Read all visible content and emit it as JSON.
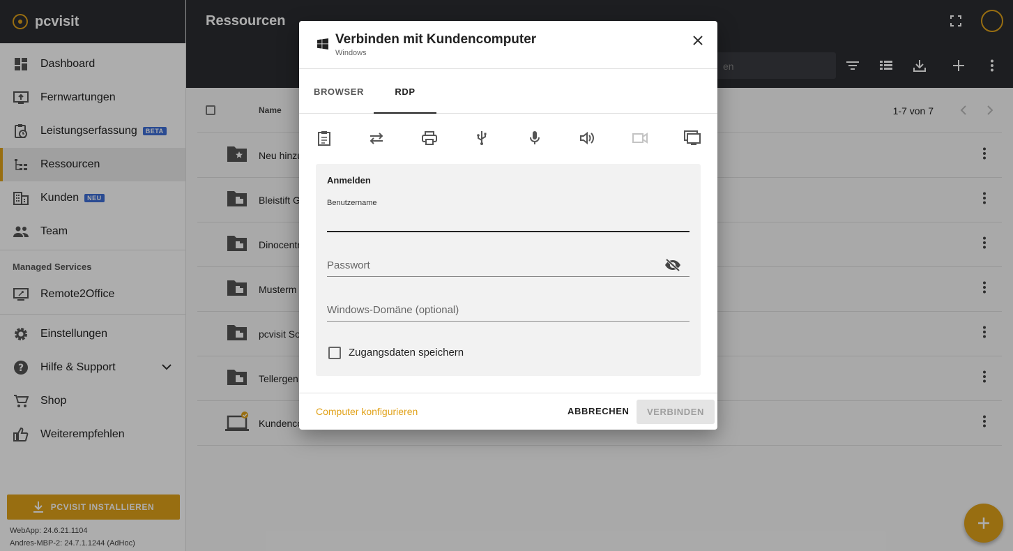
{
  "sidebar": {
    "brand": "pcvisit",
    "items": [
      {
        "label": "Dashboard",
        "icon": "dashboard-icon"
      },
      {
        "label": "Fernwartungen",
        "icon": "remote-icon"
      },
      {
        "label": "Leistungserfassung",
        "icon": "time-tracking-icon",
        "badge": "BETA"
      },
      {
        "label": "Ressourcen",
        "icon": "resources-icon",
        "active": true
      },
      {
        "label": "Kunden",
        "icon": "customers-icon",
        "badge": "NEU"
      },
      {
        "label": "Team",
        "icon": "team-icon"
      }
    ],
    "section_title": "Managed Services",
    "section_items": [
      {
        "label": "Remote2Office",
        "icon": "remote2office-icon"
      }
    ],
    "bottom_items": [
      {
        "label": "Einstellungen",
        "icon": "gear-icon"
      },
      {
        "label": "Hilfe & Support",
        "icon": "help-icon"
      },
      {
        "label": "Shop",
        "icon": "cart-icon"
      },
      {
        "label": "Weiterempfehlen",
        "icon": "thumbs-up-icon"
      }
    ],
    "install_label": "PCVISIT INSTALLIEREN",
    "webapp_version": "WebApp: 24.6.21.1104",
    "host_version": "Andres-MBP-2: 24.7.1.1244 (AdHoc)"
  },
  "header": {
    "title": "Ressourcen",
    "search_placeholder_fragment": "en"
  },
  "table": {
    "column_name": "Name",
    "pagination": "1-7 von 7",
    "rows": [
      {
        "name": "Neu hinzu",
        "icon": "folder-star-icon"
      },
      {
        "name": "Bleistift G",
        "icon": "folder-building-icon"
      },
      {
        "name": "Dinocentr",
        "icon": "folder-building-icon"
      },
      {
        "name": "Musterm",
        "icon": "folder-building-icon"
      },
      {
        "name": "pcvisit So",
        "icon": "folder-building-icon"
      },
      {
        "name": "Tellergen",
        "icon": "folder-building-icon"
      },
      {
        "name": "Kundenco",
        "icon": "laptop-check-icon"
      }
    ]
  },
  "dialog": {
    "title": "Verbinden mit Kundencomputer",
    "subtitle": "Windows",
    "tabs": [
      {
        "label": "BROWSER",
        "active": false
      },
      {
        "label": "RDP",
        "active": true
      }
    ],
    "features": [
      {
        "icon": "clipboard-icon",
        "enabled": true
      },
      {
        "icon": "transfer-icon",
        "enabled": true
      },
      {
        "icon": "printer-icon",
        "enabled": true
      },
      {
        "icon": "usb-icon",
        "enabled": true
      },
      {
        "icon": "microphone-icon",
        "enabled": true
      },
      {
        "icon": "speaker-icon",
        "enabled": true
      },
      {
        "icon": "camera-icon",
        "enabled": false
      },
      {
        "icon": "multi-monitor-icon",
        "enabled": true
      }
    ],
    "login_title": "Anmelden",
    "username_label": "Benutzername",
    "username_value": "",
    "password_placeholder": "Passwort",
    "domain_placeholder": "Windows-Domäne (optional)",
    "save_credentials_label": "Zugangsdaten speichern",
    "save_credentials_checked": false,
    "configure_link": "Computer konfigurieren",
    "cancel_label": "ABBRECHEN",
    "connect_label": "VERBINDEN"
  },
  "colors": {
    "accent": "#e1a21a",
    "header_bg": "#2b2d31",
    "badge_blue": "#3f6fd8"
  }
}
